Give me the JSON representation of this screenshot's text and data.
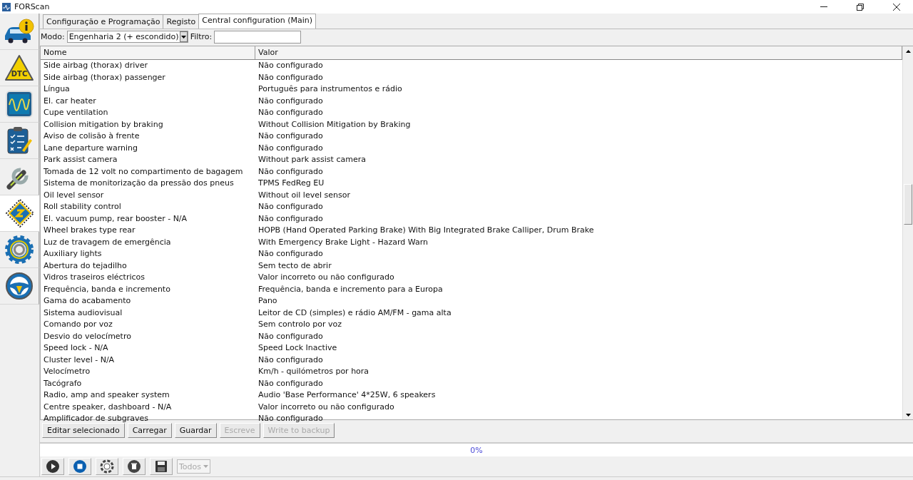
{
  "window": {
    "title": "FORScan"
  },
  "sidebar": {
    "items": [
      {
        "kind": "info",
        "selected": false
      },
      {
        "kind": "dtc",
        "label": "DTC",
        "selected": false
      },
      {
        "kind": "scope",
        "selected": false
      },
      {
        "kind": "checklist",
        "selected": false
      },
      {
        "kind": "wrench",
        "selected": false
      },
      {
        "kind": "chip",
        "selected": true
      },
      {
        "kind": "gear",
        "selected": false
      },
      {
        "kind": "help",
        "selected": false
      }
    ]
  },
  "tabs": [
    {
      "label": "Configuração e Programação",
      "selected": false
    },
    {
      "label": "Registo",
      "selected": false
    },
    {
      "label": "Central configuration (Main)",
      "selected": true
    }
  ],
  "mode": {
    "label": "Modo:",
    "value": "Engenharia 2 (+ escondido)"
  },
  "filter": {
    "label": "Filtro:"
  },
  "table": {
    "columns": [
      "Nome",
      "Valor"
    ],
    "rows": [
      [
        "Side airbag (thorax) driver",
        "Não configurado"
      ],
      [
        "Side airbag (thorax) passenger",
        "Não configurado"
      ],
      [
        "Língua",
        "Português para instrumentos e rádio"
      ],
      [
        "El. car heater",
        "Não configurado"
      ],
      [
        "Cupe ventilation",
        "Não configurado"
      ],
      [
        "Collision mitigation by braking",
        "Without Collision Mitigation by Braking"
      ],
      [
        "Aviso de colisão à frente",
        "Não configurado"
      ],
      [
        "Lane departure warning",
        "Não configurado"
      ],
      [
        "Park assist camera",
        "Without park assist camera"
      ],
      [
        "Tomada de 12 volt no compartimento de bagagem",
        "Não configurado"
      ],
      [
        "Sistema de monitorização da pressão dos pneus",
        "TPMS FedReg EU"
      ],
      [
        "Oil level sensor",
        "Without oil level sensor"
      ],
      [
        "Roll stability control",
        "Não configurado"
      ],
      [
        "El. vacuum pump, rear booster - N/A",
        "Não configurado"
      ],
      [
        "Wheel brakes type rear",
        "HOPB (Hand Operated Parking Brake) With Big Integrated Brake Calliper, Drum Brake"
      ],
      [
        "Luz de travagem de emergência",
        "With Emergency Brake Light - Hazard Warn"
      ],
      [
        "Auxiliary lights",
        "Não configurado"
      ],
      [
        "Abertura do tejadilho",
        "Sem tecto de abrir"
      ],
      [
        "Vidros traseiros eléctricos",
        "Valor incorreto ou não configurado"
      ],
      [
        "Frequência, banda e incremento",
        "Frequência, banda e incremento para a Europa"
      ],
      [
        "Gama do acabamento",
        "Pano"
      ],
      [
        "Sistema audiovisual",
        "Leitor de CD (simples) e rádio AM/FM - gama alta"
      ],
      [
        "Comando por voz",
        "Sem controlo por voz"
      ],
      [
        "Desvio do velocímetro",
        "Não configurado"
      ],
      [
        "Speed lock - N/A",
        "Speed Lock Inactive"
      ],
      [
        "Cluster level - N/A",
        "Não configurado"
      ],
      [
        "Velocímetro",
        "Km/h - quilómetros por hora"
      ],
      [
        "Tacógrafo",
        "Não configurado"
      ],
      [
        "Radio, amp and speaker system",
        "Audio 'Base Performance' 4*25W, 6 speakers"
      ],
      [
        "Centre speaker, dashboard - N/A",
        "Valor incorreto ou não configurado"
      ],
      [
        "Amplificador de subgraves",
        "Não configurado"
      ]
    ]
  },
  "buttons": [
    {
      "label": "Editar selecionado",
      "disabled": false
    },
    {
      "label": "Carregar",
      "disabled": false
    },
    {
      "label": "Guardar",
      "disabled": false
    },
    {
      "label": "Escreve",
      "disabled": true
    },
    {
      "label": "Write to backup",
      "disabled": true
    }
  ],
  "progress": {
    "text": "0%",
    "level": 0
  },
  "toolbar": {
    "tools": [
      {
        "kind": "play"
      },
      {
        "kind": "stop"
      },
      {
        "kind": "help"
      },
      {
        "kind": "trash"
      },
      {
        "kind": "save"
      }
    ],
    "log_filter": {
      "value": "Todos",
      "disabled": true
    }
  }
}
